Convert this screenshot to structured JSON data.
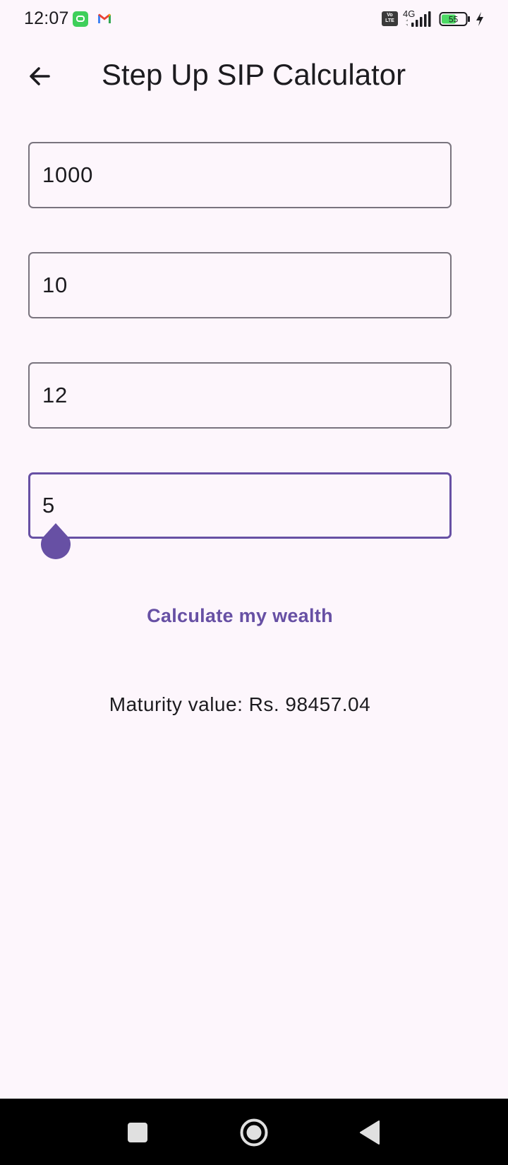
{
  "status_bar": {
    "time": "12:07",
    "network": "4G",
    "volte_top": "Vo",
    "volte_bottom": "LTE",
    "battery": "55",
    "notification_icons": [
      "app-notification-icon",
      "gmail-icon"
    ]
  },
  "app_bar": {
    "title": "Step Up SIP Calculator",
    "back_icon": "arrow-left-icon"
  },
  "form": {
    "field_1_value": "1000",
    "field_2_value": "10",
    "field_3_value": "12",
    "field_4_value": "5",
    "focused_field": 4
  },
  "actions": {
    "calculate_label": "Calculate my wealth"
  },
  "result": {
    "text": "Maturity value: Rs. 98457.04"
  },
  "nav_bar": {
    "buttons": [
      "recents-icon",
      "home-icon",
      "back-icon"
    ]
  },
  "colors": {
    "background": "#fdf6fc",
    "accent": "#6750a4",
    "outline": "#79747e",
    "text": "#1c1b1f",
    "nav_bar": "#000000",
    "battery_fill": "#4cd964"
  }
}
